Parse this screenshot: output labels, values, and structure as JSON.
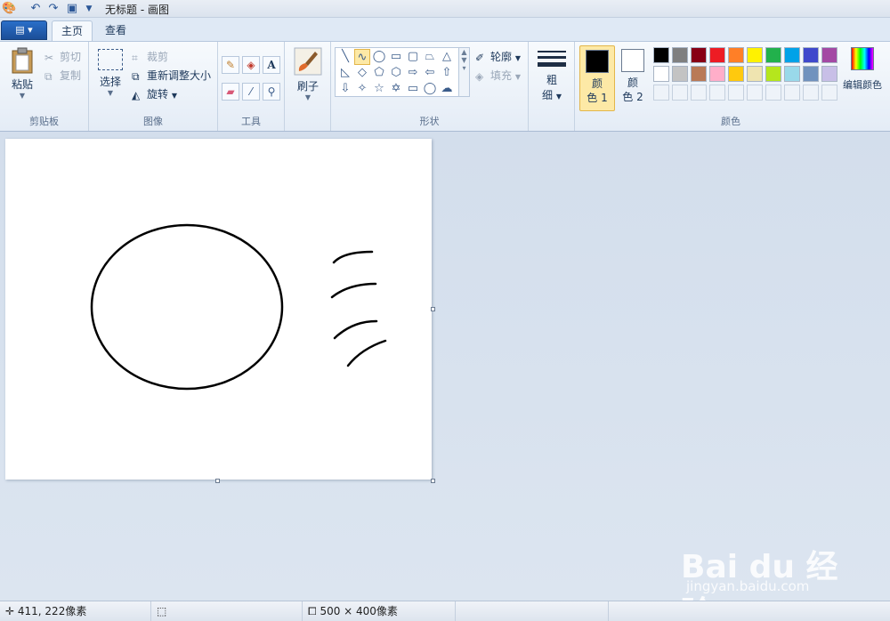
{
  "window": {
    "title": "无标题 - 画图"
  },
  "tabs": {
    "home": "主页",
    "view": "查看"
  },
  "clipboard": {
    "paste": "粘贴",
    "cut": "剪切",
    "copy": "复制",
    "label": "剪贴板"
  },
  "image": {
    "select": "选择",
    "crop": "裁剪",
    "resize": "重新调整大小",
    "rotate": "旋转",
    "label": "图像"
  },
  "tools": {
    "label": "工具",
    "text_tool_glyph": "A"
  },
  "brushes": {
    "label": "刷子"
  },
  "shapes": {
    "outline": "轮廓",
    "fill": "填充",
    "label": "形状"
  },
  "size": {
    "line1": "粗",
    "line2": "细"
  },
  "colors": {
    "color1_line1": "颜",
    "color1_line2": "色 1",
    "color2_line1": "颜",
    "color2_line2": "色 2",
    "color1_value": "#000000",
    "color2_value": "#ffffff",
    "edit": "编辑颜色",
    "label": "颜色",
    "palette_row1": [
      "#000000",
      "#7f7f7f",
      "#880015",
      "#ed1c24",
      "#ff7f27",
      "#fff200",
      "#22b14c",
      "#00a2e8",
      "#3f48cc",
      "#a349a4"
    ],
    "palette_row2": [
      "#ffffff",
      "#c3c3c3",
      "#b97a57",
      "#ffaec9",
      "#ffc90e",
      "#efe4b0",
      "#b5e61d",
      "#99d9ea",
      "#7092be",
      "#c8bfe7"
    ]
  },
  "status": {
    "cursor_pos": "411, 222像素",
    "image_size": "500 × 400像素"
  },
  "watermark": {
    "brand": "Bai du 经验",
    "url": "jingyan.baidu.com"
  }
}
